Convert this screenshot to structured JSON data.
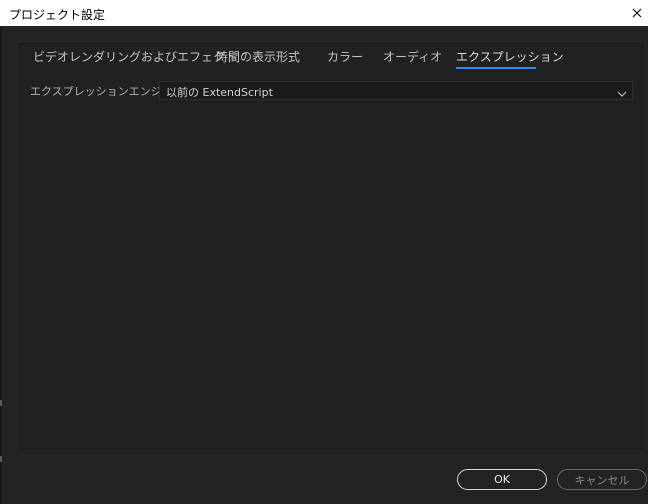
{
  "window": {
    "title": "プロジェクト設定",
    "close_icon": "close-icon"
  },
  "tabs": [
    {
      "label": "ビデオレンダリングおよびエフェクト",
      "active": false
    },
    {
      "label": "時間の表示形式",
      "active": false
    },
    {
      "label": "カラー",
      "active": false
    },
    {
      "label": "オーディオ",
      "active": false
    },
    {
      "label": "エクスプレッション",
      "active": true
    }
  ],
  "expression": {
    "engine_label": "エクスプレッションエンジン：",
    "engine_value": "以前の ExtendScript"
  },
  "buttons": {
    "ok": "OK",
    "cancel": "キャンセル"
  },
  "colors": {
    "accent": "#2d8ceb",
    "background": "#232323",
    "titlebar": "#ffffff"
  }
}
